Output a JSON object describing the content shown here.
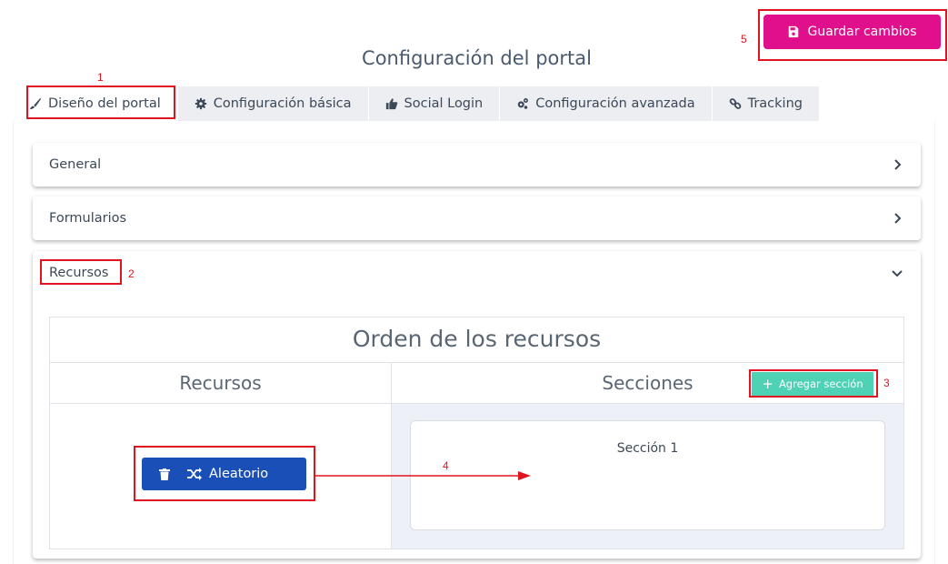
{
  "header": {
    "save_label": "Guardar cambios",
    "save_icon": "floppy-disk-icon",
    "page_title": "Configuración del portal",
    "save_color": "#e0108c"
  },
  "tabs": [
    {
      "label": "Diseño del portal",
      "icon": "brush-icon",
      "active": true
    },
    {
      "label": "Configuración básica",
      "icon": "gear-icon",
      "active": false
    },
    {
      "label": "Social Login",
      "icon": "thumbs-up-icon",
      "active": false
    },
    {
      "label": "Configuración avanzada",
      "icon": "gears-icon",
      "active": false
    },
    {
      "label": "Tracking",
      "icon": "link-icon",
      "active": false
    }
  ],
  "accordion": {
    "general": "General",
    "formularios": "Formularios",
    "recursos": "Recursos"
  },
  "resources_panel": {
    "title": "Orden de los recursos",
    "col_resources": "Recursos",
    "col_sections": "Secciones",
    "add_section_label": "Agregar sección",
    "resource_item": "Aleatorio",
    "section_name": "Sección 1",
    "accent_color": "#1b4fb8",
    "add_color": "#4fd1b5"
  },
  "annotations": [
    "1",
    "2",
    "3",
    "4",
    "5"
  ]
}
